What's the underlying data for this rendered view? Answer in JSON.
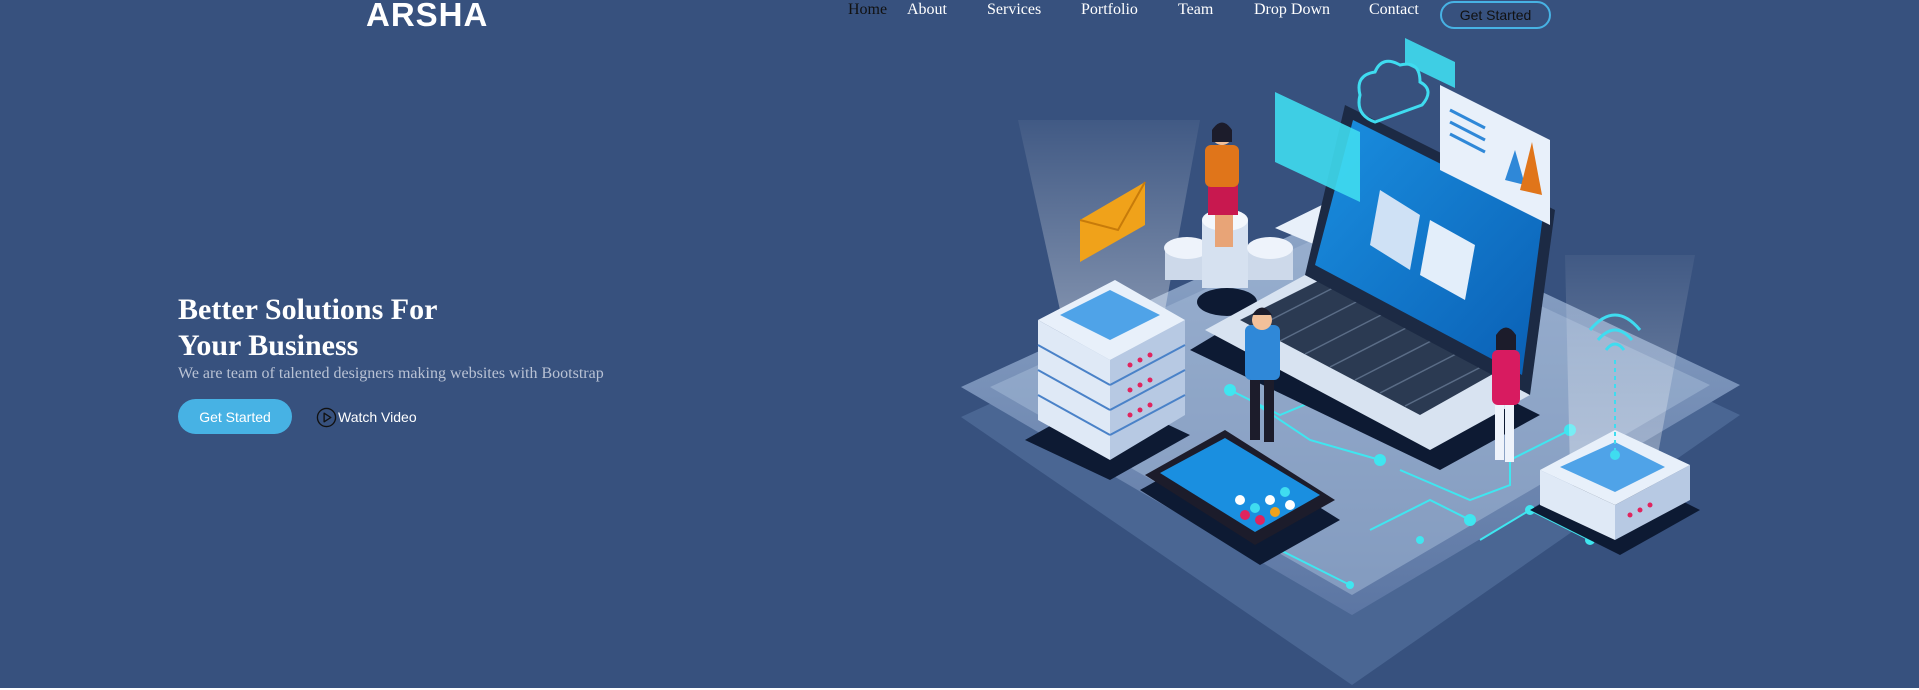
{
  "brand": {
    "logo_text": "ARSHA"
  },
  "nav": {
    "items": [
      {
        "label": "Home",
        "active": true
      },
      {
        "label": "About"
      },
      {
        "label": "Services"
      },
      {
        "label": "Portfolio"
      },
      {
        "label": "Team"
      },
      {
        "label": "Drop Down"
      },
      {
        "label": "Contact"
      }
    ],
    "cta_label": "Get Started"
  },
  "hero": {
    "title_line1": "Better Solutions For",
    "title_line2": "Your Business",
    "subtitle": "We are team of talented designers making websites with Bootstrap",
    "primary_button": "Get Started",
    "video_button": "Watch Video",
    "video_icon": "play-circle-icon",
    "illustration": "isometric-tech-illustration"
  },
  "colors": {
    "background": "#37517e",
    "accent": "#47b2e4",
    "text": "#ffffff"
  }
}
